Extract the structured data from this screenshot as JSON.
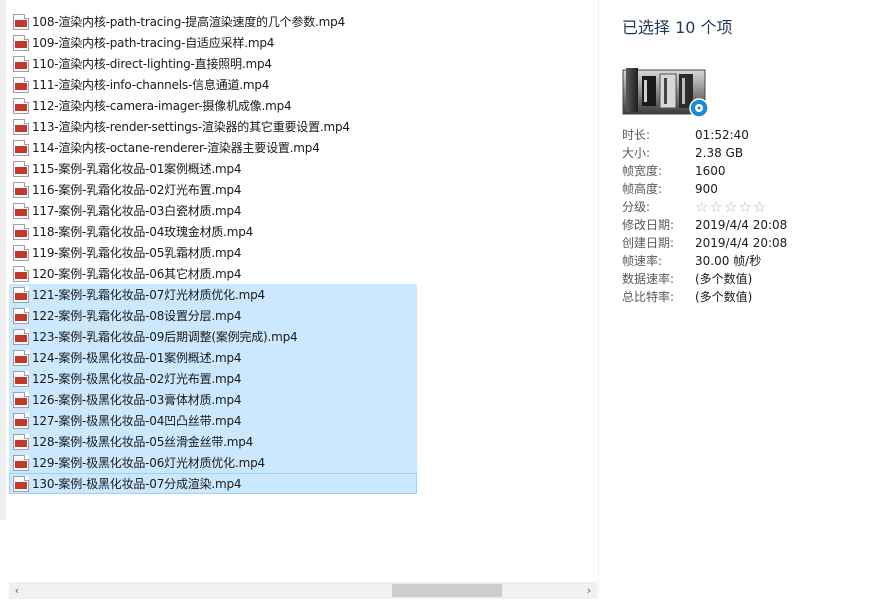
{
  "files": [
    {
      "name": "108-渲染内核-path-tracing-提高渲染速度的几个参数.mp4",
      "selected": false
    },
    {
      "name": "109-渲染内核-path-tracing-自适应采样.mp4",
      "selected": false
    },
    {
      "name": "110-渲染内核-direct-lighting-直接照明.mp4",
      "selected": false
    },
    {
      "name": "111-渲染内核-info-channels-信息通道.mp4",
      "selected": false
    },
    {
      "name": "112-渲染内核-camera-imager-摄像机成像.mp4",
      "selected": false
    },
    {
      "name": "113-渲染内核-render-settings-渲染器的其它重要设置.mp4",
      "selected": false
    },
    {
      "name": "114-渲染内核-octane-renderer-渲染器主要设置.mp4",
      "selected": false
    },
    {
      "name": "115-案例-乳霜化妆品-01案例概述.mp4",
      "selected": false
    },
    {
      "name": "116-案例-乳霜化妆品-02灯光布置.mp4",
      "selected": false
    },
    {
      "name": "117-案例-乳霜化妆品-03白瓷材质.mp4",
      "selected": false
    },
    {
      "name": "118-案例-乳霜化妆品-04玫瑰金材质.mp4",
      "selected": false
    },
    {
      "name": "119-案例-乳霜化妆品-05乳霜材质.mp4",
      "selected": false
    },
    {
      "name": "120-案例-乳霜化妆品-06其它材质.mp4",
      "selected": false
    },
    {
      "name": "121-案例-乳霜化妆品-07灯光材质优化.mp4",
      "selected": true
    },
    {
      "name": "122-案例-乳霜化妆品-08设置分层.mp4",
      "selected": true
    },
    {
      "name": "123-案例-乳霜化妆品-09后期调整(案例完成).mp4",
      "selected": true
    },
    {
      "name": "124-案例-极黑化妆品-01案例概述.mp4",
      "selected": true
    },
    {
      "name": "125-案例-极黑化妆品-02灯光布置.mp4",
      "selected": true
    },
    {
      "name": "126-案例-极黑化妆品-03膏体材质.mp4",
      "selected": true
    },
    {
      "name": "127-案例-极黑化妆品-04凹凸丝带.mp4",
      "selected": true
    },
    {
      "name": "128-案例-极黑化妆品-05丝滑金丝带.mp4",
      "selected": true
    },
    {
      "name": "129-案例-极黑化妆品-06灯光材质优化.mp4",
      "selected": true
    },
    {
      "name": "130-案例-极黑化妆品-07分成渲染.mp4",
      "selected": true,
      "focused": true
    }
  ],
  "file_icon": "mp4-file-icon",
  "scrollbar": {
    "left_arrow": "‹",
    "right_arrow": "›"
  },
  "details": {
    "title": "已选择 10 个项",
    "thumbnail_icon": "video-folder-icon",
    "properties": [
      {
        "label": "时长:",
        "value": "01:52:40"
      },
      {
        "label": "大小:",
        "value": "2.38 GB"
      },
      {
        "label": "帧宽度:",
        "value": "1600"
      },
      {
        "label": "帧高度:",
        "value": "900"
      },
      {
        "label": "分级:",
        "rating": 0,
        "max": 5
      },
      {
        "label": "修改日期:",
        "value": "2019/4/4 20:08"
      },
      {
        "label": "创建日期:",
        "value": "2019/4/4 20:08"
      },
      {
        "label": "帧速率:",
        "value": "30.00 帧/秒"
      },
      {
        "label": "数据速率:",
        "value": "(多个数值)"
      },
      {
        "label": "总比特率:",
        "value": "(多个数值)"
      }
    ]
  },
  "colors": {
    "selection_bg": "#cce8ff",
    "selection_border": "#99d1ff",
    "title_text": "#1e395b"
  }
}
